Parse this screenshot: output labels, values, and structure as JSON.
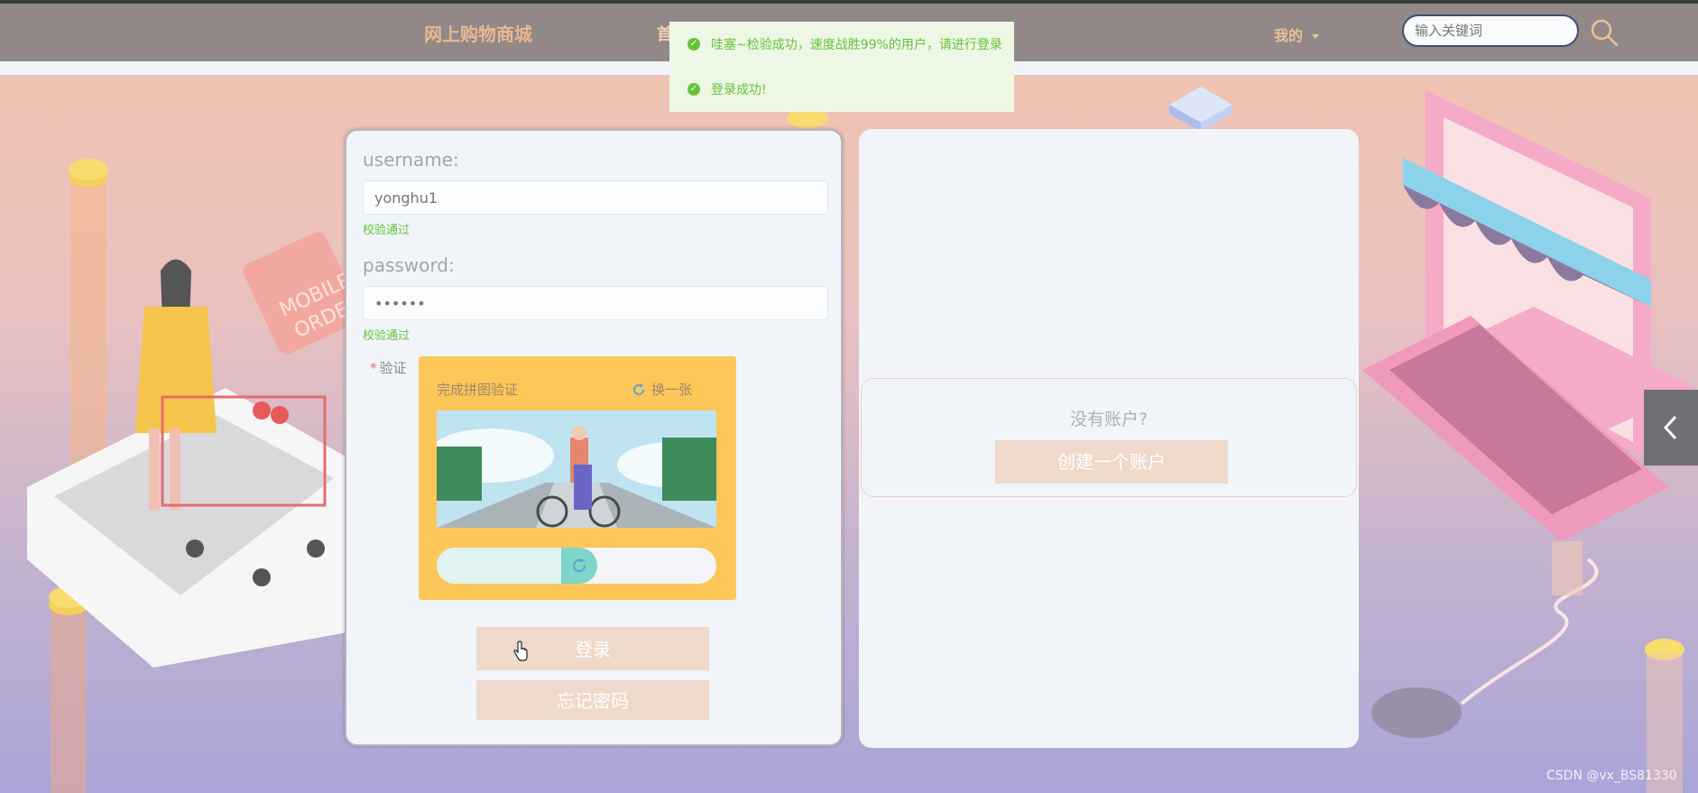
{
  "header": {
    "brand": "网上购物商城",
    "nav_first": "首",
    "mine_label": "我的",
    "search_placeholder": "输入关键词"
  },
  "notifications": [
    {
      "text": "哇塞~检验成功，速度战胜99%的用户，请进行登录"
    },
    {
      "text": "登录成功!"
    }
  ],
  "login": {
    "username_label": "username:",
    "username_value": "yonghu1",
    "username_status": "校验通过",
    "password_label": "password:",
    "password_value": "••••••",
    "password_status": "校验通过",
    "verify_label": "验证",
    "captcha": {
      "title": "完成拼图验证",
      "refresh_label": "换一张",
      "slider_progress_fraction": 0.45
    },
    "login_button": "登录",
    "forgot_button": "忘记密码"
  },
  "register": {
    "question": "没有账户?",
    "create_button": "创建一个账户"
  },
  "watermark": "CSDN @vx_BS81330",
  "colors": {
    "header_bg": "#928887",
    "brand": "#e9b78f",
    "success": "#67c23a",
    "captcha_bg": "#fcc658",
    "button_bg": "#eed9ca",
    "card_bg": "#f1f5f9"
  },
  "decor_text": {
    "sign_line1": "MOBILE",
    "sign_line2": "ORDER"
  }
}
